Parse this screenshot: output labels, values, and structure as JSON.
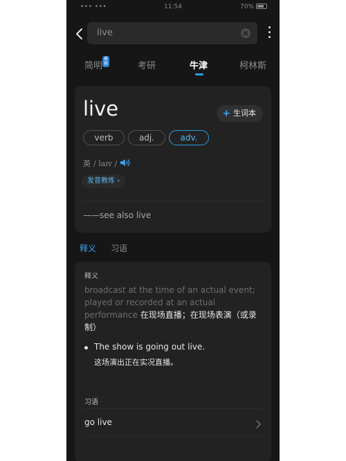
{
  "status_bar": {
    "carrier": "••• •••",
    "time": "11:54",
    "battery": "70%"
  },
  "search": {
    "value": "live"
  },
  "tabs": [
    {
      "label": "简明",
      "badge": "推荐"
    },
    {
      "label": "考研"
    },
    {
      "label": "牛津"
    },
    {
      "label": "柯林斯"
    }
  ],
  "entry": {
    "headword": "live",
    "vocab_button": "生词本",
    "pos": [
      "verb",
      "adj.",
      "adv."
    ],
    "phonetic_prefix": "英",
    "phonetic": "/ laɪv /",
    "coach_label": "发音教练 ›",
    "see_also": "——see also live"
  },
  "section_tabs": [
    "释义",
    "习语"
  ],
  "definition": {
    "heading": "释义",
    "text_en": "broadcast at the time of an actual event; played or recorded at an actual performance",
    "text_cn": "在现场直播；在现场表演（或录制）",
    "example_en": "The show is going out live.",
    "example_cn": "这场演出正在实况直播。"
  },
  "idioms": {
    "heading": "习语",
    "items": [
      "go live"
    ]
  },
  "colors": {
    "accent": "#2b9fe0",
    "background": "#161616",
    "card": "#222222"
  }
}
